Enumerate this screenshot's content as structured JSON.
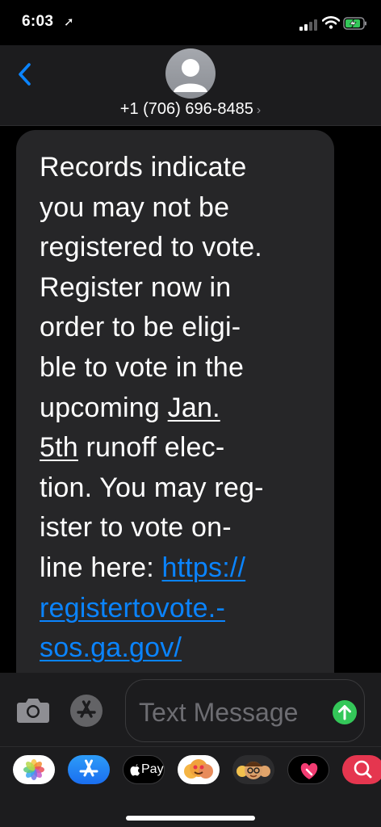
{
  "status_bar": {
    "time": "6:03"
  },
  "header": {
    "contact": "+1 (706) 696-8485",
    "back_icon": "chevron-left-icon",
    "accent": "#0a84ff"
  },
  "message": {
    "line1": "Records indicate",
    "line2": "you may not be",
    "line3": "registered to vote.",
    "line4": "Register now in",
    "line5": "order to be eligi-",
    "line6": "ble to vote in the",
    "line7_text": "upcoming ",
    "line7_date": "Jan.",
    "line8_date": "5th",
    "line8_text": " runoff elec-",
    "line9": "tion. You may reg-",
    "line10": "ister to vote on-",
    "line11_text": "line here: ",
    "line11_link": "https://",
    "line12_link": "registertovote.-",
    "line13_link": "sos.ga.gov/",
    "link_color": "#0a84ff"
  },
  "composer": {
    "placeholder": "Text Message",
    "send_color": "#34c759"
  },
  "app_drawer": {
    "apple_pay_label": "Pay",
    "apps": [
      "photos-icon",
      "app-store-icon",
      "apple-pay-icon",
      "animoji-icon",
      "memoji-icon",
      "digital-touch-icon",
      "image-search-icon"
    ]
  }
}
